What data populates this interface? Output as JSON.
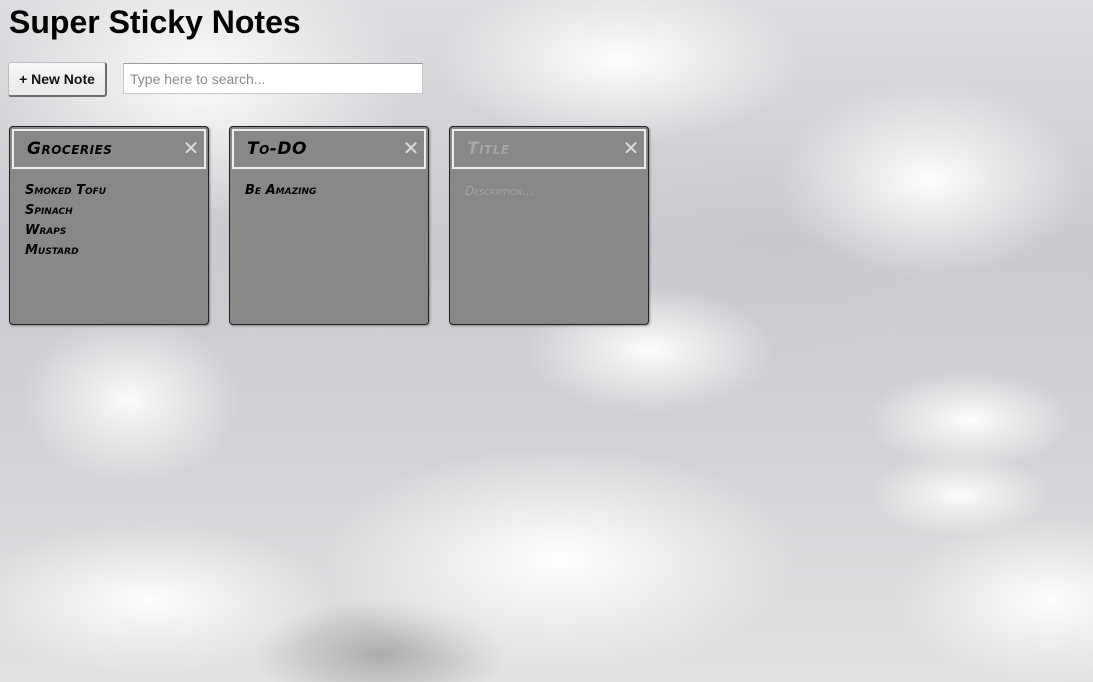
{
  "app": {
    "title": "Super Sticky Notes"
  },
  "toolbar": {
    "new_note_label": "+ New Note",
    "search_placeholder": "Type here to search...",
    "search_value": ""
  },
  "notes": [
    {
      "title": "Groceries",
      "description_lines": [
        "Smoked Tofu",
        "Spinach",
        "Wraps",
        "Mustard"
      ],
      "close_glyph": "✕"
    },
    {
      "title": "To-DO",
      "description_lines": [
        "Be Amazing"
      ],
      "close_glyph": "✕"
    },
    {
      "title": "",
      "title_placeholder": "Title",
      "description_placeholder": "Description...",
      "close_glyph": "✕"
    }
  ],
  "colors": {
    "note_bg": "#888888",
    "note_header_border": "#eeeeee",
    "placeholder_text": "#a6a6a6"
  },
  "icons": {
    "close": "close-icon"
  }
}
